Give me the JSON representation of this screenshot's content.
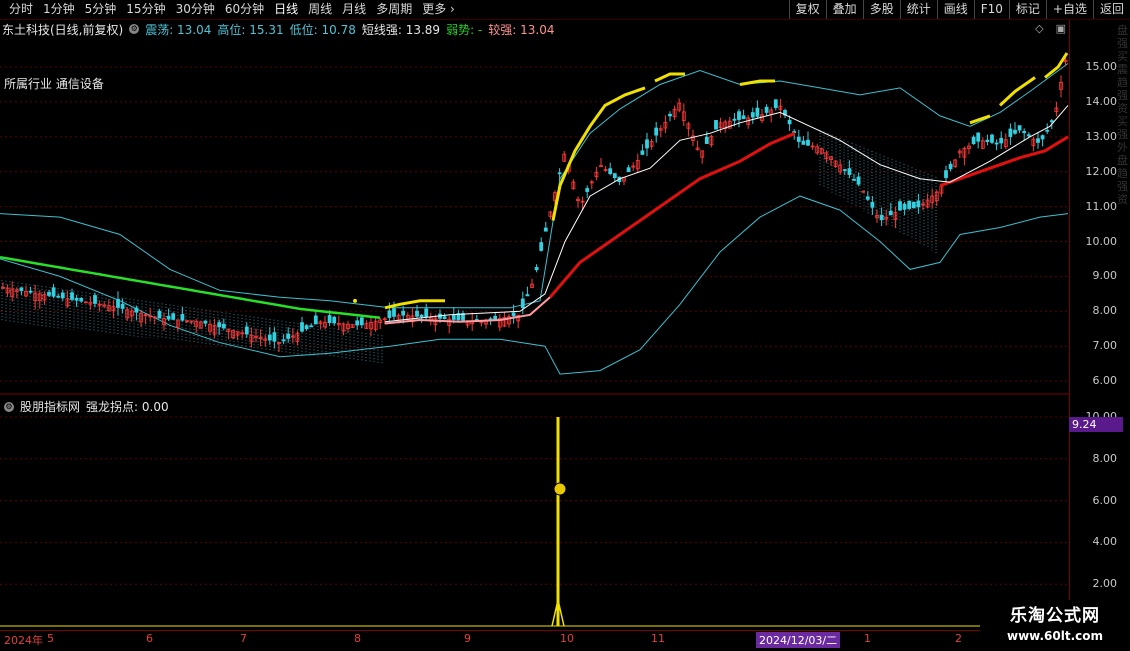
{
  "toolbar": {
    "left": [
      "分时",
      "1分钟",
      "5分钟",
      "15分钟",
      "30分钟",
      "60分钟",
      "日线",
      "周线",
      "月线",
      "多周期",
      "更多"
    ],
    "active": "日线",
    "right": [
      "复权",
      "叠加",
      "多股",
      "统计",
      "画线",
      "F10",
      "标记",
      "+自选",
      "返回"
    ]
  },
  "info": {
    "stock": "东土科技(日线,前复权)",
    "zhendang": "震荡: 13.04",
    "gaowei": "高位: 15.31",
    "diwei": "低位: 10.78",
    "duanxian": "短线强: 13.89",
    "ruoshi": "弱势: -",
    "jiaoqiang": "较强: 13.04"
  },
  "industry": "所属行业 通信设备",
  "price_axis": [
    "15.00",
    "14.00",
    "13.00",
    "12.00",
    "11.00",
    "10.00",
    "9.00",
    "8.00",
    "7.00",
    "6.00"
  ],
  "sub_axis": [
    "10.00",
    "8.00",
    "6.00",
    "4.00",
    "2.00"
  ],
  "sub_indicator": {
    "title": "股朋指标网",
    "label": "强龙拐点: 0.00",
    "value_box": "9.24"
  },
  "date_axis": {
    "labels": [
      "2024年",
      "5",
      "6",
      "7",
      "8",
      "9",
      "10",
      "11",
      "12/03/二",
      "1",
      "2"
    ],
    "highlight": "2024/12/03/二"
  },
  "watermark": {
    "title": "乐淘公式网",
    "url": "www.60lt.com"
  },
  "side_text": "盘强买震趋强资买强外盘趋强资",
  "colors": {
    "up": "#ff3a3a",
    "down": "#33d0e0",
    "signal": "#f0e000",
    "ma_white": "#ffffff",
    "ma_red": "#e01010",
    "band": "#3cc0d0",
    "green_line": "#28e028"
  }
}
